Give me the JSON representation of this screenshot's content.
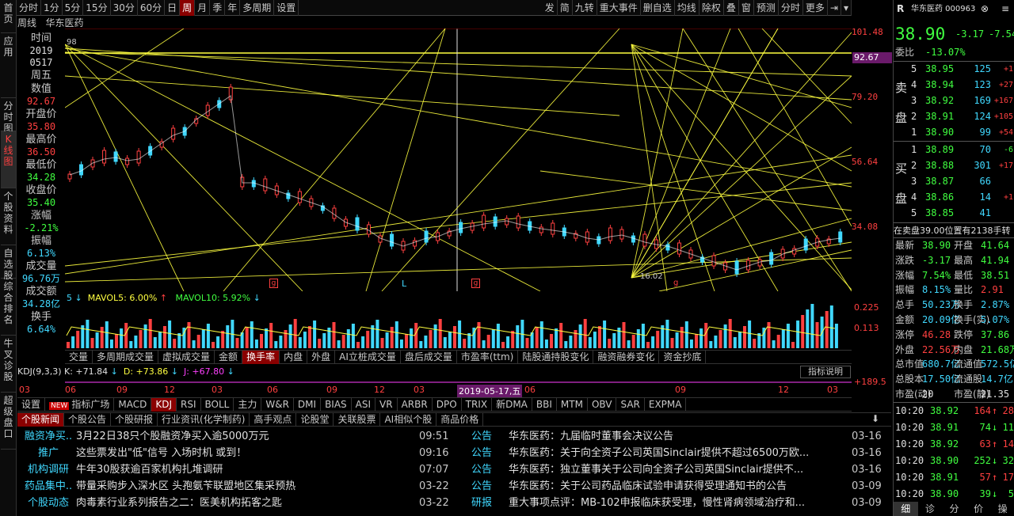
{
  "left_nav": [
    "首页",
    "应用",
    "分时图",
    "K线图",
    "个股资料",
    "自选股",
    "综合排名",
    "牛叉诊股",
    "超级盘口"
  ],
  "top_tabs": [
    "分时",
    "1分",
    "5分",
    "15分",
    "30分",
    "60分",
    "日",
    "周",
    "月",
    "季",
    "年",
    "多周期",
    "设置"
  ],
  "active_top_tab": "周",
  "top_right": [
    "发",
    "简",
    "九转",
    "重大事件",
    "删自选",
    "均线",
    "除权",
    "叠",
    "窗",
    "预测",
    "分时",
    "更多"
  ],
  "chart_title": {
    "period": "周线",
    "name": "华东医药"
  },
  "info_panel": [
    {
      "k": "时间",
      "v": "2019\n0517",
      "c": "white"
    },
    {
      "k": "周五",
      "v": "",
      "c": "white"
    },
    {
      "k": "数值",
      "v": "92.67",
      "c": "red"
    },
    {
      "k": "开盘价",
      "v": "35.80",
      "c": "red"
    },
    {
      "k": "最高价",
      "v": "36.50",
      "c": "red"
    },
    {
      "k": "最低价",
      "v": "34.28",
      "c": "green"
    },
    {
      "k": "收盘价",
      "v": "35.40",
      "c": "green"
    },
    {
      "k": "涨幅",
      "v": "-2.21%",
      "c": "green"
    },
    {
      "k": "振幅",
      "v": "6.13%",
      "c": "cyan"
    },
    {
      "k": "成交量",
      "v": "96.76万",
      "c": "cyan"
    },
    {
      "k": "成交额",
      "v": "34.28亿",
      "c": "cyan"
    },
    {
      "k": "换手",
      "v": "6.64%",
      "c": "cyan"
    }
  ],
  "price_axis": [
    "101.48",
    "92.67",
    "79.20",
    "56.64",
    "34.08"
  ],
  "price_tag": "92.67",
  "chart_markers": {
    "left_top": "98",
    "bottom_low": "16.02",
    "L": "L"
  },
  "vol_axis": [
    "0.225",
    "0.113"
  ],
  "vol_legend": {
    "mavol5": "MAVOL5: 6.00%",
    "mavol10": "MAVOL10: 5.92%"
  },
  "indicator_tabs": [
    "交量",
    "多周期成交量",
    "虚拟成交量",
    "金额",
    "换手率",
    "内盘",
    "外盘",
    "AI立桩成交量",
    "盘后成交量",
    "市盈率(ttm)",
    "陆股通持股变化",
    "融资融券变化",
    "资金抄底"
  ],
  "active_indicator": "换手率",
  "kdj_legend": {
    "name": "KDJ(9,3,3)",
    "k": "K: +71.84",
    "d": "D: +73.86",
    "j": "J: +67.80"
  },
  "kdj_right": "指标说明",
  "kdj_axis": "+189.5",
  "date_axis": [
    "03",
    "06",
    "09",
    "12",
    "03",
    "06",
    "09",
    "12",
    "03",
    "06",
    "09",
    "12",
    "03"
  ],
  "date_highlight": "2019-05-17,五",
  "ind_tabs2": [
    "设置",
    "指标广场",
    "MACD",
    "KDJ",
    "RSI",
    "BOLL",
    "主力",
    "W&R",
    "DMI",
    "BIAS",
    "ASI",
    "VR",
    "ARBR",
    "DPO",
    "TRIX",
    "新DMA",
    "BBI",
    "MTM",
    "OBV",
    "SAR",
    "EXPMA"
  ],
  "new_badge": "NEW",
  "active_ind2": "KDJ",
  "news_tabs": [
    "个股新闻",
    "个股公告",
    "个股研报",
    "行业资讯(化学制药)",
    "高手观点",
    "论股堂",
    "关联股票",
    "AI相似个股",
    "商品价格"
  ],
  "news_left": [
    {
      "tag": "融资净买..",
      "title": "3月22日38只个股融资净买入逾5000万元",
      "time": "09:51"
    },
    {
      "tag": "推广",
      "title": "这些票发出\"低\"信号 入场时机 或到！",
      "time": "09:16"
    },
    {
      "tag": "机构调研",
      "title": "牛年30股获逾百家机构扎堆调研",
      "time": "07:07"
    },
    {
      "tag": "药品集中..",
      "title": "带量采购步入深水区 头孢氨苄联盟地区集采预热",
      "time": "03-22"
    },
    {
      "tag": "个股动态",
      "title": "肉毒素行业系列报告之二：医美机构拓客之匙",
      "time": "03-22"
    }
  ],
  "news_right": [
    {
      "tag": "公告",
      "title": "华东医药：九届临时董事会决议公告",
      "time": "03-16"
    },
    {
      "tag": "公告",
      "title": "华东医药：关于向全资子公司英国Sinclair提供不超过6500万欧...",
      "time": "03-16"
    },
    {
      "tag": "公告",
      "title": "华东医药：独立董事关于公司向全资子公司英国Sinclair提供不...",
      "time": "03-16"
    },
    {
      "tag": "公告",
      "title": "华东医药：关于公司药品临床试验申请获得受理通知书的公告",
      "time": "03-09"
    },
    {
      "tag": "研报",
      "title": "重大事项点评：MB-102申报临床获受理，慢性肾病领域治疗和...",
      "time": "03-09"
    }
  ],
  "right_panel": {
    "code_name": "华东医药 000963",
    "price": "38.90",
    "change": "-3.17",
    "pct": "-7.54",
    "weibi_label": "委比",
    "weibi": "-13.07%",
    "sell": [
      {
        "n": "5",
        "p": "38.95",
        "v": "125",
        "d": "+1"
      },
      {
        "n": "4",
        "p": "38.94",
        "v": "123",
        "d": "+27"
      },
      {
        "n": "3",
        "p": "38.92",
        "v": "169",
        "d": "+167"
      },
      {
        "n": "2",
        "p": "38.91",
        "v": "124",
        "d": "+105"
      },
      {
        "n": "1",
        "p": "38.90",
        "v": "99",
        "d": "+54"
      }
    ],
    "buy": [
      {
        "n": "1",
        "p": "38.89",
        "v": "70",
        "d": "-6"
      },
      {
        "n": "2",
        "p": "38.88",
        "v": "301",
        "d": "+17"
      },
      {
        "n": "3",
        "p": "38.87",
        "v": "66",
        "d": ""
      },
      {
        "n": "4",
        "p": "38.86",
        "v": "14",
        "d": "+1"
      },
      {
        "n": "5",
        "p": "38.85",
        "v": "41",
        "d": ""
      }
    ],
    "sell_label": [
      "卖",
      "盘"
    ],
    "buy_label": [
      "买",
      "盘"
    ],
    "queue": "在卖盘39.00位置有2138手转",
    "stats": [
      {
        "k1": "最新",
        "v1": "38.90",
        "c1": "green",
        "k2": "开盘",
        "v2": "41.64",
        "c2": "green"
      },
      {
        "k1": "涨跌",
        "v1": "-3.17",
        "c1": "green",
        "k2": "最高",
        "v2": "41.94",
        "c2": "green"
      },
      {
        "k1": "涨幅",
        "v1": "7.54%",
        "c1": "green",
        "k2": "最低",
        "v2": "38.51",
        "c2": "green"
      },
      {
        "k1": "振幅",
        "v1": "8.15%",
        "c1": "cyan",
        "k2": "量比",
        "v2": "2.91",
        "c2": "red"
      },
      {
        "k1": "总手",
        "v1": "50.23万",
        "c1": "cyan",
        "k2": "换手",
        "v2": "2.87%",
        "c2": "cyan"
      },
      {
        "k1": "金额",
        "v1": "20.09亿",
        "c1": "cyan",
        "k2": "换手(实)",
        "v2": "5.07%",
        "c2": "cyan"
      },
      {
        "k1": "涨停",
        "v1": "46.28",
        "c1": "red",
        "k2": "跌停",
        "v2": "37.86",
        "c2": "green"
      },
      {
        "k1": "外盘",
        "v1": "22.56万",
        "c1": "red",
        "k2": "内盘",
        "v2": "21.68万",
        "c2": "green"
      },
      {
        "k1": "总市值",
        "v1": "680.7亿",
        "c1": "cyan",
        "k2": "流通值",
        "v2": "572.5亿",
        "c2": "cyan"
      },
      {
        "k1": "总股本",
        "v1": "17.50亿",
        "c1": "cyan",
        "k2": "流通股",
        "v2": "14.7亿",
        "c2": "cyan"
      },
      {
        "k1": "市盈(动)",
        "v1": "20",
        "c1": "white",
        "k2": "市盈(静)",
        "v2": "21.35",
        "c2": "white"
      }
    ],
    "ticks": [
      {
        "t": "10:20",
        "p": "38.92",
        "v": "164",
        "d": "↑",
        "n": "28"
      },
      {
        "t": "10:20",
        "p": "38.91",
        "v": "74",
        "d": "↓",
        "n": "11"
      },
      {
        "t": "10:20",
        "p": "38.92",
        "v": "63",
        "d": "↑",
        "n": "14"
      },
      {
        "t": "10:20",
        "p": "38.90",
        "v": "252",
        "d": "↓",
        "n": "32"
      },
      {
        "t": "10:20",
        "p": "38.91",
        "v": "57",
        "d": "↑",
        "n": "17"
      },
      {
        "t": "10:20",
        "p": "38.90",
        "v": "39",
        "d": "↓",
        "n": "5"
      }
    ],
    "bottom_tabs": [
      "细",
      "诊",
      "分",
      "价",
      "操"
    ]
  },
  "colors": {
    "up": "#ff4040",
    "down": "#40ff40",
    "line": "#ffff40",
    "vol": "#40d8ff"
  }
}
